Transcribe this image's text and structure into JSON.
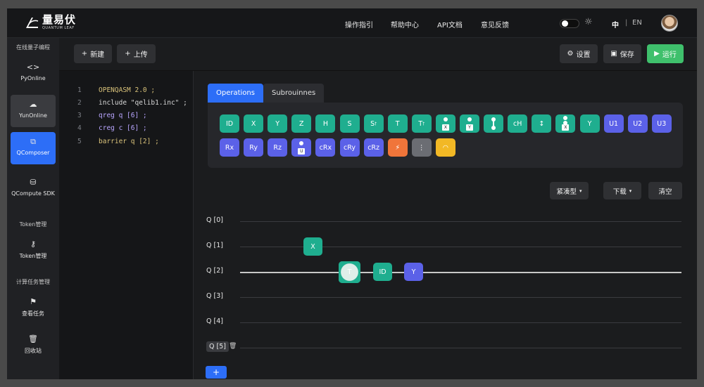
{
  "header": {
    "logo_cn": "量易伏",
    "logo_en": "QUANTUM LEAF",
    "nav": [
      "操作指引",
      "帮助中心",
      "API文档",
      "意见反馈"
    ],
    "lang_zh": "中",
    "lang_sep": "|",
    "lang_en": "EN"
  },
  "sidebar": {
    "section_online": "在线量子编程",
    "items": [
      {
        "icon": "<>",
        "label": "PyOnline"
      },
      {
        "icon": "☁",
        "label": "YunOnline"
      },
      {
        "icon": "⧉",
        "label": "QComposer"
      },
      {
        "icon": "⛁",
        "label": "QCompute SDK"
      }
    ],
    "section_token": "Token管理",
    "token_item": {
      "icon": "⚷",
      "label": "Token管理"
    },
    "section_tasks": "计算任务管理",
    "task_items": [
      {
        "icon": "⚑",
        "label": "查看任务"
      },
      {
        "icon": "🗑",
        "label": "回收站"
      }
    ]
  },
  "toolbar": {
    "new_label": "新建",
    "upload_label": "上传",
    "settings_label": "设置",
    "save_label": "保存",
    "run_label": "运行"
  },
  "editor": {
    "lines": [
      {
        "n": "1",
        "text": "OPENQASM 2.0 ;"
      },
      {
        "n": "2",
        "text": "include \"qelib1.inc\" ;"
      },
      {
        "n": "3",
        "text": "qreg q [6] ;"
      },
      {
        "n": "4",
        "text": "creg c [6] ;"
      },
      {
        "n": "5",
        "text": "barrier  q [2] ;"
      }
    ]
  },
  "composer": {
    "tabs": [
      "Operations",
      "Subrouinnes"
    ],
    "gates_row1": [
      {
        "label": "ID",
        "color": "#1fae8f"
      },
      {
        "label": "X",
        "color": "#1fae8f"
      },
      {
        "label": "Y",
        "color": "#1fae8f"
      },
      {
        "label": "Z",
        "color": "#1fae8f"
      },
      {
        "label": "H",
        "color": "#1fae8f"
      },
      {
        "label": "S",
        "color": "#1fae8f"
      },
      {
        "label": "S",
        "sup": "†",
        "color": "#1fae8f"
      },
      {
        "label": "T",
        "color": "#1fae8f"
      },
      {
        "label": "T",
        "sup": "†",
        "color": "#1fae8f"
      },
      {
        "label": "X",
        "kind": "ctrl-mini",
        "color": "#1fae8f"
      },
      {
        "label": "Y",
        "kind": "ctrl-mini",
        "color": "#1fae8f"
      },
      {
        "label": "",
        "kind": "ctrl-ctrl",
        "color": "#1fae8f"
      },
      {
        "label": "cH",
        "color": "#1fae8f"
      },
      {
        "label": "↕",
        "color": "#1fae8f"
      },
      {
        "label": "X",
        "kind": "two-ctrl-mini",
        "color": "#1fae8f"
      },
      {
        "label": "Y",
        "color": "#1fae8f"
      },
      {
        "label": "U1",
        "color": "#5b61e8"
      },
      {
        "label": "U2",
        "color": "#5b61e8"
      },
      {
        "label": "U3",
        "color": "#5b61e8"
      }
    ],
    "gates_row2": [
      {
        "label": "Rx",
        "color": "#5b61e8"
      },
      {
        "label": "Ry",
        "color": "#5b61e8"
      },
      {
        "label": "Rz",
        "color": "#5b61e8"
      },
      {
        "label": "U",
        "kind": "ctrl-mini",
        "color": "#5b61e8"
      },
      {
        "label": "cRx",
        "color": "#5b61e8"
      },
      {
        "label": "cRy",
        "color": "#5b61e8"
      },
      {
        "label": "cRz",
        "color": "#5b61e8"
      },
      {
        "label": "⚡",
        "color": "#f0753a"
      },
      {
        "label": "⋮",
        "color": "#6b6d73"
      },
      {
        "label": "◠",
        "color": "#f2b825"
      }
    ],
    "layout_label": "紧凑型",
    "download_label": "下载",
    "clear_label": "清空",
    "qubits": [
      "Q [0]",
      "Q [1]",
      "Q [2]",
      "Q [3]",
      "Q [4]",
      "Q [5]"
    ],
    "circuit_gates": [
      {
        "label": "X",
        "qubit": 1,
        "color": "#1fae8f"
      },
      {
        "label": "T",
        "qubit": 2,
        "color": "#1fae8f"
      },
      {
        "label": "ID",
        "qubit": 2,
        "color": "#1fae8f"
      },
      {
        "label": "Y",
        "qubit": 2,
        "color": "#5b61e8"
      }
    ],
    "add_label": "+"
  }
}
